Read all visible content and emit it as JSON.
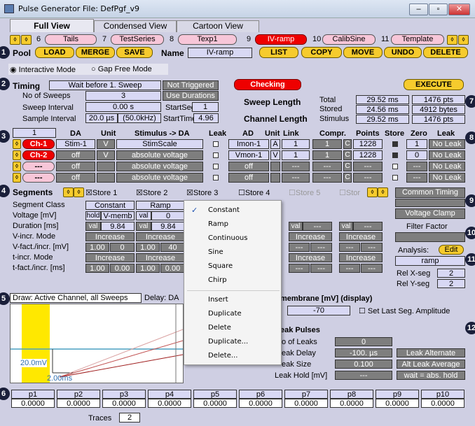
{
  "window": {
    "title": "Pulse Generator File: DefPgf_v9",
    "minimize": "–",
    "maximize": "▫",
    "close": "✕"
  },
  "tabs": [
    "Full View",
    "Condensed View",
    "Cartoon View"
  ],
  "sequences": [
    {
      "num": "6",
      "label": "Tails"
    },
    {
      "num": "7",
      "label": "TestSeries"
    },
    {
      "num": "8",
      "label": "Texp1"
    },
    {
      "num": "9",
      "label": "IV-ramp"
    },
    {
      "num": "10",
      "label": "CalibSine"
    },
    {
      "num": "11",
      "label": "Template"
    }
  ],
  "pool": {
    "label": "Pool",
    "load": "LOAD",
    "merge": "MERGE",
    "save": "SAVE",
    "name_label": "Name",
    "name_value": "IV-ramp",
    "list": "LIST",
    "copy": "COPY",
    "move": "MOVE",
    "undo": "UNDO",
    "delete": "DELETE"
  },
  "modes": {
    "interactive": "Interactive Mode",
    "gapfree": "Gap Free Mode"
  },
  "timing": {
    "label": "Timing",
    "wait": "Wait before 1. Sweep",
    "trigger": "Not Triggered",
    "checking": "Checking",
    "execute": "EXECUTE",
    "sweeps_label": "No of Sweeps",
    "sweeps": "3",
    "use_durations": "Use Durations",
    "interval_label": "Sweep Interval",
    "interval": "0.00 s",
    "startseg_label": "StartSeg",
    "startseg": "1",
    "sample_label": "Sample Interval",
    "sample": "20.0 µs",
    "sample_freq": "(50.0kHz)",
    "starttime_label": "StartTime",
    "starttime": "4.96"
  },
  "sweep_length": {
    "label": "Sweep Length",
    "channel_label": "Channel Length",
    "total_label": "Total",
    "stored_label": "Stored",
    "stimulus_label": "Stimulus",
    "total_ms": "29.52 ms",
    "total_pts": "1476 pts",
    "stored_ms": "24.56 ms",
    "stored_bytes": "4912 bytes",
    "stim_ms": "29.52 ms",
    "stim_pts": "1476 pts"
  },
  "channels": {
    "count": "1",
    "headers": {
      "da": "DA",
      "unit": "Unit",
      "stim": "Stimulus -> DA",
      "leak": "Leak",
      "ad": "AD",
      "adunit": "Unit",
      "link": "Link",
      "compr": "Compr.",
      "points": "Points",
      "store": "Store",
      "zero": "Zero",
      "leak2": "Leak"
    },
    "rows": [
      {
        "ch": "Ch-1",
        "da": "Stim-1",
        "unit": "V",
        "stim": "StimScale",
        "ad": "Imon-1",
        "adunit": "A",
        "link": "1",
        "compr": "1",
        "c": "C",
        "points": "1228",
        "zero": "1",
        "leak": "No Leak"
      },
      {
        "ch": "Ch-2",
        "da": "off",
        "unit": "V",
        "stim": "absolute voltage",
        "ad": "Vmon-1",
        "adunit": "V",
        "link": "1",
        "compr": "1",
        "c": "C",
        "points": "1228",
        "zero": "0",
        "leak": "No Leak"
      },
      {
        "ch": "---",
        "da": "off",
        "unit": "",
        "stim": "absolute voltage",
        "ad": "off",
        "adunit": "",
        "link": "---",
        "compr": "---",
        "c": "C",
        "points": "---",
        "zero": "---",
        "leak": "No Leak"
      },
      {
        "ch": "---",
        "da": "off",
        "unit": "",
        "stim": "absolute voltage",
        "ad": "off",
        "adunit": "",
        "link": "---",
        "compr": "---",
        "c": "C",
        "points": "---",
        "zero": "---",
        "leak": "No Leak"
      }
    ]
  },
  "segments": {
    "label": "Segments",
    "stores": [
      "Store 1",
      "Store 2",
      "Store 3",
      "Store 4",
      "Store 5",
      "Stor"
    ],
    "row_labels": [
      "Segment Class",
      "Voltage [mV]",
      "Duration [ms]",
      "V-incr. Mode",
      "V-fact./incr. [mV]",
      "t-incr. Mode",
      "t-fact./incr. [ms]"
    ],
    "seg1": {
      "class": "Constant",
      "volt_mode": "hold",
      "volt": "V-memb",
      "dur_mode": "val",
      "dur": "9.84",
      "vincr": "Increase",
      "vfact": "1.00",
      "vinc": "0",
      "tincr": "Increase",
      "tfact": "1.00",
      "tinc": "0.00"
    },
    "seg2": {
      "class": "Ramp",
      "volt_mode": "val",
      "volt": "0",
      "dur_mode": "val",
      "dur": "9.84",
      "vincr": "Increase",
      "vfact": "1.00",
      "vinc": "40",
      "tincr": "Increase",
      "tfact": "1.00",
      "tinc": "0.00"
    },
    "val": "val",
    "dash": "---",
    "increase": "Increase"
  },
  "right_panel": {
    "common_timing": "Common Timing",
    "voltage_clamp": "Voltage Clamp",
    "filter_factor": "Filter Factor",
    "analysis": "Analysis:",
    "edit": "Edit",
    "ramp": "ramp",
    "relx_label": "Rel X-seg",
    "relx": "2",
    "rely_label": "Rel Y-seg",
    "rely": "2"
  },
  "context_menu": [
    "Constant",
    "Ramp",
    "Continuous",
    "Sine",
    "Square",
    "Chirp",
    "Insert",
    "Duplicate",
    "Delete",
    "Duplicate...",
    "Delete..."
  ],
  "draw": {
    "title": "Draw: Active Channel, all Sweeps",
    "delay": "Delay: DA",
    "y_label": "20.0mV",
    "x_label": "2.00ms"
  },
  "membrane": {
    "label": "membrane [mV]  (display)",
    "value": "-70",
    "set_last": "Set Last Seg. Amplitude"
  },
  "leak": {
    "label": "eak Pulses",
    "num_label": "o of Leaks",
    "num": "0",
    "delay_label": "eak Delay",
    "delay": "-100. µs",
    "size_label": "eak Size",
    "size": "0.100",
    "hold_label": "Leak Hold [mV]",
    "hold": "---",
    "alternate": "Leak Alternate",
    "alt_avg": "Alt Leak Average",
    "wait": "wait = abs. hold"
  },
  "params": [
    {
      "name": "p1",
      "value": "0.0000"
    },
    {
      "name": "p2",
      "value": "0.0000"
    },
    {
      "name": "p3",
      "value": "0.0000"
    },
    {
      "name": "p4",
      "value": "0.0000"
    },
    {
      "name": "p5",
      "value": "0.0000"
    },
    {
      "name": "p6",
      "value": "0.0000"
    },
    {
      "name": "p7",
      "value": "0.0000"
    },
    {
      "name": "p8",
      "value": "0.0000"
    },
    {
      "name": "p9",
      "value": "0.0000"
    },
    {
      "name": "p10",
      "value": "0.0000"
    }
  ],
  "traces": {
    "label": "Traces",
    "value": "2"
  },
  "badges": [
    "1",
    "2",
    "3",
    "4",
    "5",
    "6",
    "7",
    "8",
    "9",
    "10",
    "11",
    "12"
  ],
  "colors": {
    "yellow": "#f6cb2d",
    "pink": "#f7c6d8",
    "red": "#e00000",
    "field": "#d8d8f4",
    "gray": "#7e7e7e",
    "badge": "#1a1f3a"
  }
}
